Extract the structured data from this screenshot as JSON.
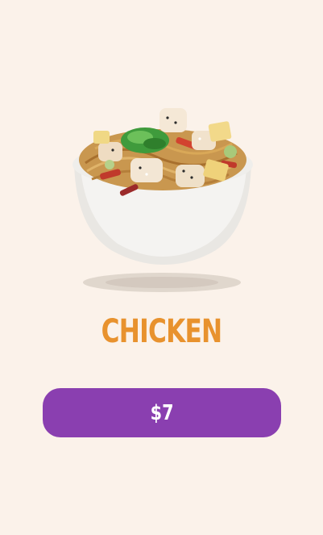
{
  "product": {
    "name": "CHICKEN",
    "price_label": "$7",
    "image_icon": "noodle-bowl-icon"
  },
  "colors": {
    "background": "#fbf2ea",
    "title": "#e8922e",
    "button": "#8a3fb0",
    "button_text": "#ffffff"
  }
}
